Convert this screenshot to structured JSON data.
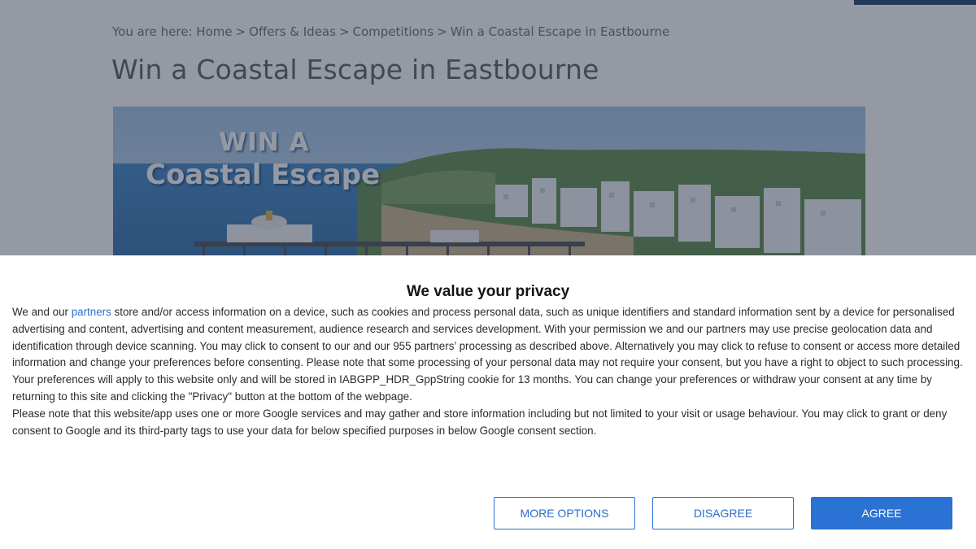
{
  "breadcrumb": {
    "prefix": "You are here:",
    "items": [
      "Home",
      "Offers & Ideas",
      "Competitions",
      "Win a Coastal Escape in Eastbourne"
    ],
    "separator": ">"
  },
  "page": {
    "title": "Win a Coastal Escape in Eastbourne"
  },
  "hero": {
    "line1": "WIN A",
    "line2": "Coastal Escape"
  },
  "consent": {
    "title": "We value your privacy",
    "p1_before_link": "We and our ",
    "p1_link": "partners",
    "p1_after_link": " store and/or access information on a device, such as cookies and process personal data, such as unique identifiers and standard information sent by a device for personalised advertising and content, advertising and content measurement, audience research and services development. With your permission we and our partners may use precise geolocation data and identification through device scanning. You may click to consent to our and our 955 partners’ processing as described above. Alternatively you may click to refuse to consent or access more detailed information and change your preferences before consenting. Please note that some processing of your personal data may not require your consent, but you have a right to object to such processing. Your preferences will apply to this website only and will be stored in IABGPP_HDR_GppString cookie for 13 months. You can change your preferences or withdraw your consent at any time by returning to this site and clicking the \"Privacy\" button at the bottom of the webpage.",
    "p2": "Please note that this website/app uses one or more Google services and may gather and store information including but not limited to your visit or usage behaviour. You may click to grant or deny consent to Google and its third-party tags to use your data for below specified purposes in below Google consent section.",
    "buttons": {
      "more_options": "MORE OPTIONS",
      "disagree": "DISAGREE",
      "agree": "AGREE"
    }
  },
  "colors": {
    "accent": "#2a72d3",
    "link": "#2c6fd1",
    "overlay": "#2a3448"
  }
}
